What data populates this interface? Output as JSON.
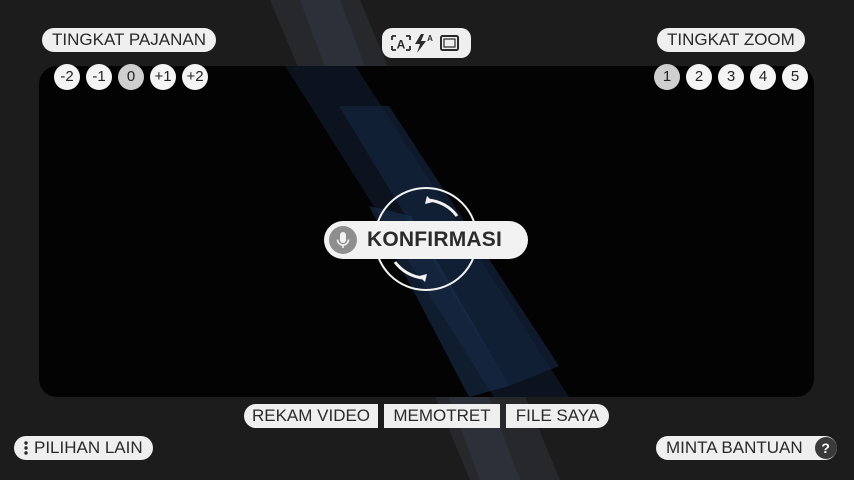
{
  "exposure": {
    "title": "TINGKAT PAJANAN",
    "levels": [
      "-2",
      "-1",
      "0",
      "+1",
      "+2"
    ],
    "selected": "0"
  },
  "zoom": {
    "title": "TINGKAT ZOOM",
    "levels": [
      "1",
      "2",
      "3",
      "4",
      "5"
    ],
    "selected": "1"
  },
  "top_toolbar": {
    "icons": [
      "auto-focus-icon",
      "flash-auto-icon",
      "aspect-ratio-icon"
    ],
    "flash_badge": "A",
    "focus_letter": "A"
  },
  "center": {
    "confirm_label": "KONFIRMASI",
    "mic_icon": "microphone-icon",
    "ring_icon": "refresh-rotate-icon"
  },
  "modes": {
    "record_video": "REKAM VIDEO",
    "take_photo": "MEMOTRET",
    "my_files": "FILE SAYA"
  },
  "bottom": {
    "more_options": "PILIHAN LAIN",
    "more_icon": "more-vertical-icon",
    "help": "MINTA BANTUAN",
    "help_icon_glyph": "?"
  },
  "colors": {
    "pill_bg": "#efefef",
    "viewfinder_bg": "#030303",
    "app_bg": "#1c1c1c",
    "selected_level": "#cfcfcf"
  }
}
